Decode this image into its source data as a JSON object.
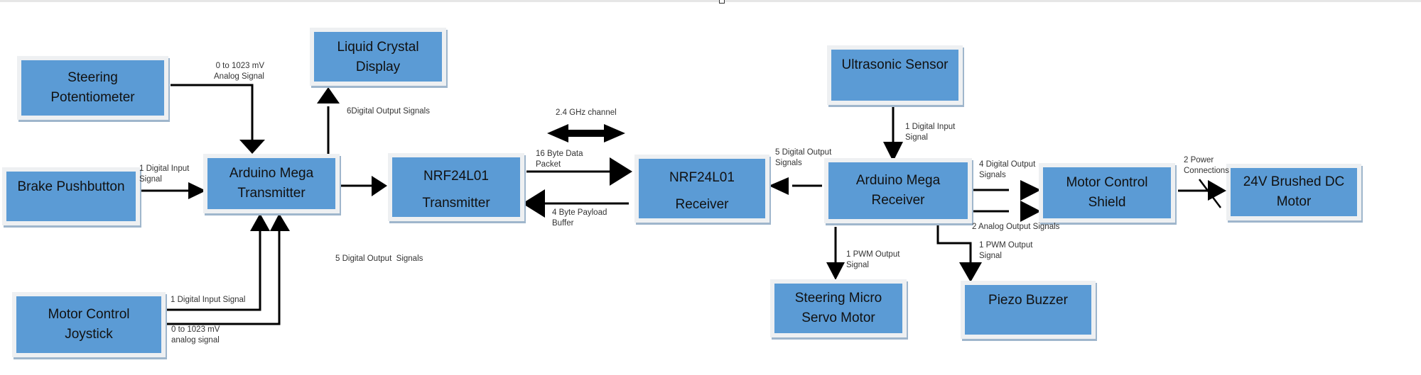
{
  "diagram": {
    "type": "block-diagram",
    "colors": {
      "block_fill": "#5b9bd5",
      "block_border": "#eef0f2",
      "wire": "#000000",
      "text": "#111111"
    },
    "blocks": {
      "steering_potentiometer": {
        "lines": [
          "Steering",
          "Potentiometer"
        ]
      },
      "brake_pushbutton": {
        "lines": [
          "Brake Pushbutton"
        ]
      },
      "motor_control_joystick": {
        "lines": [
          "Motor Control",
          "Joystick"
        ]
      },
      "lcd": {
        "lines": [
          "Liquid Crystal",
          "Display"
        ]
      },
      "arduino_tx": {
        "lines": [
          "Arduino Mega",
          "Transmitter"
        ]
      },
      "nrf_tx": {
        "lines": [
          "NRF24L01",
          "Transmitter"
        ]
      },
      "nrf_rx": {
        "lines": [
          "NRF24L01",
          "Receiver"
        ]
      },
      "ultrasonic": {
        "lines": [
          "Ultrasonic Sensor"
        ]
      },
      "arduino_rx": {
        "lines": [
          "Arduino Mega",
          "Receiver"
        ]
      },
      "motor_shield": {
        "lines": [
          "Motor Control",
          "Shield"
        ]
      },
      "dc_motor": {
        "lines": [
          "24V Brushed DC",
          "Motor"
        ]
      },
      "servo": {
        "lines": [
          "Steering Micro",
          "Servo Motor"
        ]
      },
      "piezo": {
        "lines": [
          "Piezo Buzzer"
        ]
      }
    },
    "connections": [
      {
        "from": "steering_potentiometer",
        "to": "arduino_tx",
        "label": [
          "0 to 1023 mV",
          "Analog Signal"
        ]
      },
      {
        "from": "brake_pushbutton",
        "to": "arduino_tx",
        "label": [
          "1 Digital Input",
          "Signal"
        ]
      },
      {
        "from": "motor_control_joystick",
        "to": "arduino_tx",
        "label": [
          "1 Digital Input Signal"
        ]
      },
      {
        "from": "motor_control_joystick",
        "to": "arduino_tx",
        "label": [
          "0 to 1023 mV",
          "analog signal"
        ]
      },
      {
        "from": "arduino_tx",
        "to": "lcd",
        "label": [
          "6Digital Output Signals"
        ]
      },
      {
        "from": "arduino_tx",
        "to": "nrf_tx",
        "label": [
          "5 Digital Output  Signals"
        ]
      },
      {
        "from": "nrf_tx",
        "to": "nrf_rx",
        "label": [
          "16 Byte Data",
          "Packet"
        ]
      },
      {
        "from": "nrf_rx",
        "to": "nrf_tx",
        "label": [
          "4 Byte Payload",
          "Buffer"
        ]
      },
      {
        "between": [
          "nrf_tx",
          "nrf_rx"
        ],
        "bidirectional": true,
        "label": [
          "2.4 GHz channel"
        ]
      },
      {
        "from": "ultrasonic",
        "to": "arduino_rx",
        "label": [
          "1 Digital Input",
          "Signal"
        ]
      },
      {
        "from": "arduino_rx",
        "to": "nrf_rx",
        "label": [
          "5 Digital Output",
          "Signals"
        ]
      },
      {
        "from": "arduino_rx",
        "to": "motor_shield",
        "label": [
          "4 Digital Output",
          "Signals"
        ]
      },
      {
        "from": "arduino_rx",
        "to": "motor_shield",
        "label": [
          "2 Analog Output Signals"
        ]
      },
      {
        "from": "motor_shield",
        "to": "dc_motor",
        "label": [
          "2 Power",
          "Connections"
        ]
      },
      {
        "from": "arduino_rx",
        "to": "servo",
        "label": [
          "1 PWM Output",
          "Signal"
        ]
      },
      {
        "from": "arduino_rx",
        "to": "piezo",
        "label": [
          "1 PWM Output",
          "Signal"
        ]
      }
    ]
  }
}
